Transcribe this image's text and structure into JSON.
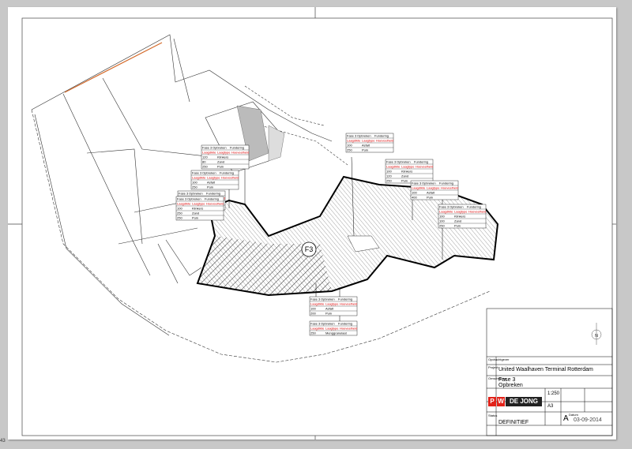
{
  "page_number": "43",
  "title_block": {
    "label_opdrachtgever": "Opdrachtgever",
    "label_project": "Project",
    "project": "United Waalhaven Terminal Rotterdam",
    "label_omschrijving": "Omschrijving",
    "description_line1": "Fase 3",
    "description_line2": "Opbreken",
    "logo_p": "P",
    "logo_w": "W",
    "logo_text": "DE JONG",
    "scale": "1:250",
    "format": "A3",
    "revision": "A",
    "label_datum": "Datum",
    "date": "03-09-2014",
    "label_status": "Status",
    "status": "DEFINITIEF"
  },
  "marker": "F3",
  "table_headers": {
    "fase": "Fase",
    "opbreken": "Opbreken",
    "fundering": "Fundering",
    "laagdikte": "Laagdikte",
    "laagtype": "Laagtype",
    "hoeveelheid": "Hoeveelheid"
  },
  "tables": [
    {
      "fase": "Fase 3",
      "rows": [
        [
          "120",
          "Klinkers"
        ],
        [
          "80",
          "Zand"
        ],
        [
          "250",
          "Puin"
        ]
      ]
    },
    {
      "fase": "Fase 3",
      "rows": [
        [
          "100",
          "Asfalt"
        ],
        [
          "250",
          "Puin"
        ]
      ]
    },
    {
      "fase": "Fase 3",
      "rows": [
        [
          "80",
          "Asfalt"
        ],
        [
          "250",
          "Puin"
        ]
      ]
    },
    {
      "fase": "Fase 3",
      "rows": [
        [
          "100",
          "Klinkers"
        ],
        [
          "250",
          "Zand"
        ],
        [
          "250",
          "Puin"
        ]
      ]
    },
    {
      "fase": "Fase 3",
      "rows": [
        [
          "100",
          "Asfalt"
        ],
        [
          "250",
          "Puin"
        ]
      ]
    },
    {
      "fase": "Fase 3",
      "rows": [
        [
          "100",
          "Klinkers"
        ],
        [
          "120",
          "Zand"
        ],
        [
          "250",
          "Puin"
        ]
      ]
    },
    {
      "fase": "Fase 3",
      "rows": [
        [
          "100",
          "Asfalt"
        ],
        [
          "400",
          "Puin"
        ]
      ]
    },
    {
      "fase": "Fase 3",
      "rows": [
        [
          "100",
          "Klinkers"
        ],
        [
          "100",
          "Zand"
        ],
        [
          "250",
          "Puin"
        ]
      ]
    },
    {
      "fase": "Fase 3",
      "rows": [
        [
          "100",
          "Asfalt"
        ],
        [
          "200",
          "Puin"
        ]
      ]
    },
    {
      "fase": "Fase 3",
      "rows": [
        [
          "250",
          "Menggranulaat"
        ]
      ]
    }
  ]
}
